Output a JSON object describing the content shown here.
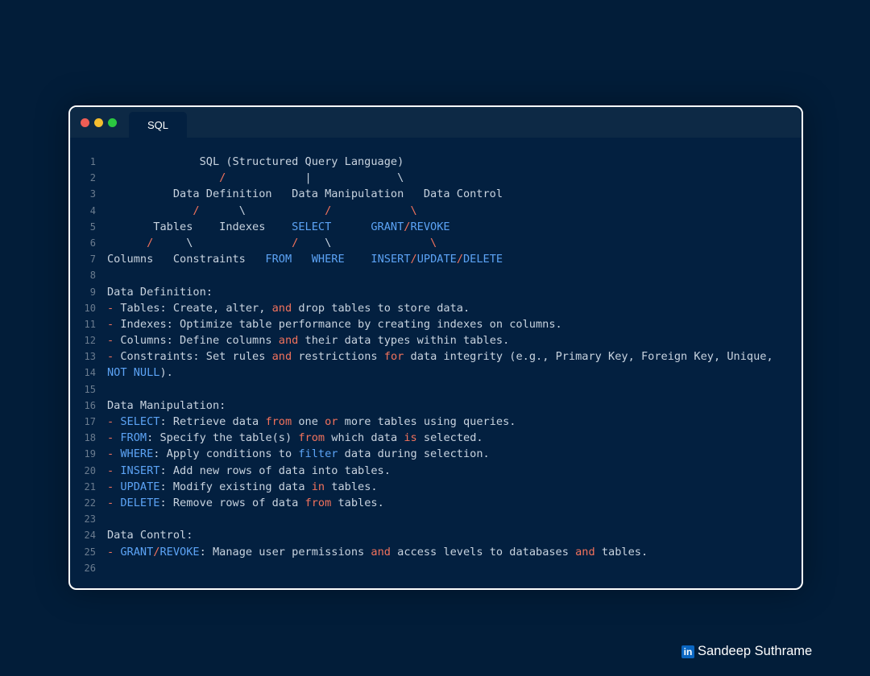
{
  "window": {
    "tab_label": "SQL"
  },
  "code_lines": [
    [
      {
        "t": "              SQL (Structured Query Language)"
      }
    ],
    [
      {
        "t": "                 "
      },
      {
        "t": "/",
        "c": "r"
      },
      {
        "t": "            |             \\"
      }
    ],
    [
      {
        "t": "          Data Definition   Data Manipulation   Data Control"
      }
    ],
    [
      {
        "t": "             "
      },
      {
        "t": "/",
        "c": "r"
      },
      {
        "t": "      \\            "
      },
      {
        "t": "/",
        "c": "r"
      },
      {
        "t": "            "
      },
      {
        "t": "\\",
        "c": "r"
      }
    ],
    [
      {
        "t": "       Tables    Indexes    "
      },
      {
        "t": "SELECT",
        "c": "k"
      },
      {
        "t": "      "
      },
      {
        "t": "GRANT",
        "c": "k"
      },
      {
        "t": "/",
        "c": "r"
      },
      {
        "t": "REVOKE",
        "c": "k"
      }
    ],
    [
      {
        "t": "      "
      },
      {
        "t": "/",
        "c": "r"
      },
      {
        "t": "     \\               "
      },
      {
        "t": "/",
        "c": "r"
      },
      {
        "t": "    \\               "
      },
      {
        "t": "\\",
        "c": "r"
      }
    ],
    [
      {
        "t": "Columns   Constraints   "
      },
      {
        "t": "FROM",
        "c": "k"
      },
      {
        "t": "   "
      },
      {
        "t": "WHERE",
        "c": "k"
      },
      {
        "t": "    "
      },
      {
        "t": "INSERT",
        "c": "k"
      },
      {
        "t": "/",
        "c": "r"
      },
      {
        "t": "UPDATE",
        "c": "k"
      },
      {
        "t": "/",
        "c": "r"
      },
      {
        "t": "DELETE",
        "c": "k"
      }
    ],
    [],
    [
      {
        "t": "Data Definition:"
      }
    ],
    [
      {
        "t": "- ",
        "c": "r"
      },
      {
        "t": "Tables: Create, alter, "
      },
      {
        "t": "and",
        "c": "r"
      },
      {
        "t": " drop tables to store data."
      }
    ],
    [
      {
        "t": "- ",
        "c": "r"
      },
      {
        "t": "Indexes: Optimize table performance by creating indexes on columns."
      }
    ],
    [
      {
        "t": "- ",
        "c": "r"
      },
      {
        "t": "Columns: Define columns "
      },
      {
        "t": "and",
        "c": "r"
      },
      {
        "t": " their data types within tables."
      }
    ],
    [
      {
        "t": "- ",
        "c": "r"
      },
      {
        "t": "Constraints: Set rules "
      },
      {
        "t": "and",
        "c": "r"
      },
      {
        "t": " restrictions "
      },
      {
        "t": "for",
        "c": "r"
      },
      {
        "t": " data integrity (e.g., Primary Key, Foreign Key, Unique,"
      }
    ],
    [
      {
        "t": "NOT NULL",
        "c": "k"
      },
      {
        "t": ")."
      }
    ],
    [],
    [
      {
        "t": "Data Manipulation:"
      }
    ],
    [
      {
        "t": "- ",
        "c": "r"
      },
      {
        "t": "SELECT",
        "c": "k"
      },
      {
        "t": ": Retrieve data "
      },
      {
        "t": "from",
        "c": "r"
      },
      {
        "t": " one "
      },
      {
        "t": "or",
        "c": "r"
      },
      {
        "t": " more tables using queries."
      }
    ],
    [
      {
        "t": "- ",
        "c": "r"
      },
      {
        "t": "FROM",
        "c": "k"
      },
      {
        "t": ": Specify the table(s) "
      },
      {
        "t": "from",
        "c": "r"
      },
      {
        "t": " which data "
      },
      {
        "t": "is",
        "c": "r"
      },
      {
        "t": " selected."
      }
    ],
    [
      {
        "t": "- ",
        "c": "r"
      },
      {
        "t": "WHERE",
        "c": "k"
      },
      {
        "t": ": Apply conditions to "
      },
      {
        "t": "filter",
        "c": "k"
      },
      {
        "t": " data during selection."
      }
    ],
    [
      {
        "t": "- ",
        "c": "r"
      },
      {
        "t": "INSERT",
        "c": "k"
      },
      {
        "t": ": Add new rows of data into tables."
      }
    ],
    [
      {
        "t": "- ",
        "c": "r"
      },
      {
        "t": "UPDATE",
        "c": "k"
      },
      {
        "t": ": Modify existing data "
      },
      {
        "t": "in",
        "c": "r"
      },
      {
        "t": " tables."
      }
    ],
    [
      {
        "t": "- ",
        "c": "r"
      },
      {
        "t": "DELETE",
        "c": "k"
      },
      {
        "t": ": Remove rows of data "
      },
      {
        "t": "from",
        "c": "r"
      },
      {
        "t": " tables."
      }
    ],
    [],
    [
      {
        "t": "Data Control:"
      }
    ],
    [
      {
        "t": "- ",
        "c": "r"
      },
      {
        "t": "GRANT",
        "c": "k"
      },
      {
        "t": "/",
        "c": "r"
      },
      {
        "t": "REVOKE",
        "c": "k"
      },
      {
        "t": ": Manage user permissions "
      },
      {
        "t": "and",
        "c": "r"
      },
      {
        "t": " access levels to databases "
      },
      {
        "t": "and",
        "c": "r"
      },
      {
        "t": " tables."
      }
    ],
    []
  ],
  "watermark": {
    "icon_text": "in",
    "name": "Sandeep Suthrame"
  },
  "colors": {
    "background": "#021d39",
    "keyword": "#5ca3f5",
    "operator": "#f2725c"
  },
  "icons": {
    "traffic_lights": [
      "close-dot",
      "minimize-dot",
      "maximize-dot"
    ],
    "brand": "linkedin-icon"
  }
}
